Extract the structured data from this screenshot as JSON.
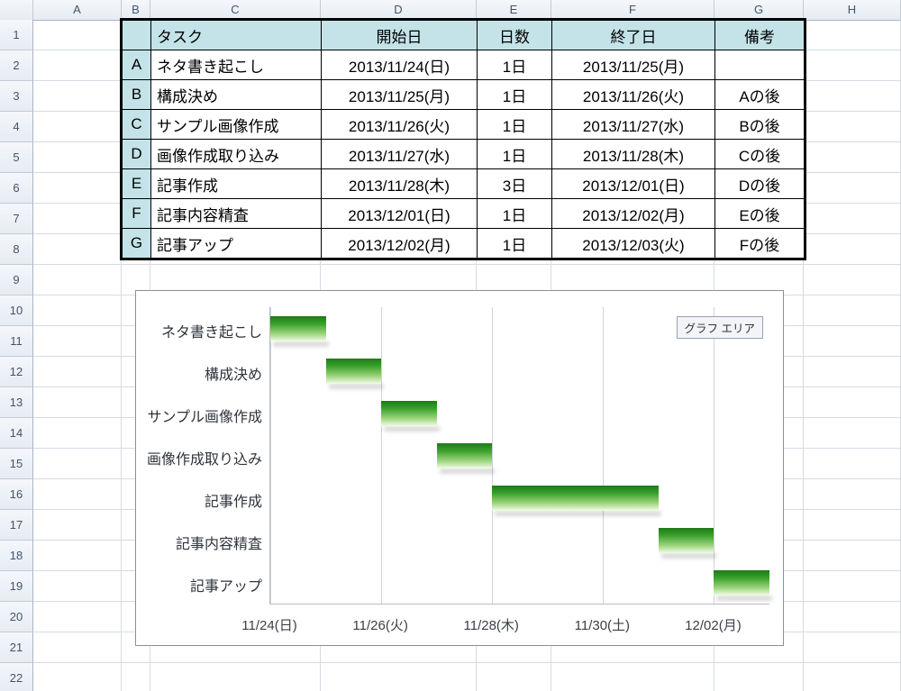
{
  "columns": [
    "A",
    "B",
    "C",
    "D",
    "E",
    "F",
    "G",
    "H"
  ],
  "row_numbers": [
    1,
    2,
    3,
    4,
    5,
    6,
    7,
    8,
    9,
    10,
    11,
    12,
    13,
    14,
    15,
    16,
    17,
    18,
    19,
    20,
    21,
    22
  ],
  "table": {
    "headers": {
      "task": "タスク",
      "start": "開始日",
      "days": "日数",
      "end": "終了日",
      "note": "備考"
    },
    "rows": [
      {
        "id": "A",
        "task": "ネタ書き起こし",
        "start": "2013/11/24(日)",
        "days": "1日",
        "end": "2013/11/25(月)",
        "note": ""
      },
      {
        "id": "B",
        "task": "構成決め",
        "start": "2013/11/25(月)",
        "days": "1日",
        "end": "2013/11/26(火)",
        "note": "Aの後"
      },
      {
        "id": "C",
        "task": "サンプル画像作成",
        "start": "2013/11/26(火)",
        "days": "1日",
        "end": "2013/11/27(水)",
        "note": "Bの後"
      },
      {
        "id": "D",
        "task": "画像作成取り込み",
        "start": "2013/11/27(水)",
        "days": "1日",
        "end": "2013/11/28(木)",
        "note": "Cの後"
      },
      {
        "id": "E",
        "task": "記事作成",
        "start": "2013/11/28(木)",
        "days": "3日",
        "end": "2013/12/01(日)",
        "note": "Dの後"
      },
      {
        "id": "F",
        "task": "記事内容精査",
        "start": "2013/12/01(日)",
        "days": "1日",
        "end": "2013/12/02(月)",
        "note": "Eの後"
      },
      {
        "id": "G",
        "task": "記事アップ",
        "start": "2013/12/02(月)",
        "days": "1日",
        "end": "2013/12/03(火)",
        "note": "Fの後"
      }
    ]
  },
  "chart_data": {
    "type": "bar",
    "orientation": "horizontal-gantt",
    "x_axis": {
      "min": "2013/11/24",
      "max": "2013/12/03",
      "ticks": [
        "11/24(日)",
        "11/26(火)",
        "11/28(木)",
        "11/30(土)",
        "12/02(月)"
      ]
    },
    "categories": [
      "ネタ書き起こし",
      "構成決め",
      "サンプル画像作成",
      "画像作成取り込み",
      "記事作成",
      "記事内容精査",
      "記事アップ"
    ],
    "series": [
      {
        "name": "offset_days",
        "values": [
          0,
          1,
          2,
          3,
          4,
          7,
          8
        ]
      },
      {
        "name": "duration_days",
        "values": [
          1,
          1,
          1,
          1,
          3,
          1,
          1
        ]
      }
    ],
    "tooltip": "グラフ エリア"
  }
}
